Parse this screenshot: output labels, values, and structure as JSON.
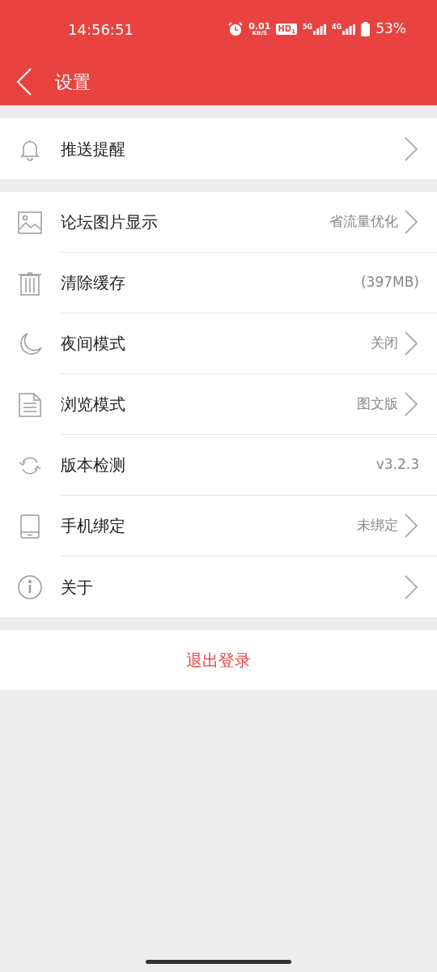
{
  "status_bar": {
    "time": "14:56:51",
    "net_speed": "0.01",
    "net_unit": "KB/S",
    "hd": "HD",
    "hd_index": "1",
    "sim1": "5G",
    "sim2": "4G",
    "battery": "53%"
  },
  "header": {
    "title": "设置"
  },
  "groups": [
    {
      "items": [
        {
          "kind": "bell",
          "label": "推送提醒",
          "chevron": true
        }
      ]
    },
    {
      "items": [
        {
          "kind": "image",
          "label": "论坛图片显示",
          "value": "省流量优化",
          "chevron": true
        },
        {
          "kind": "trash",
          "label": "清除缓存",
          "value": "(397MB)",
          "chevron": false
        },
        {
          "kind": "moon",
          "label": "夜间模式",
          "value": "关闭",
          "chevron": true
        },
        {
          "kind": "document",
          "label": "浏览模式",
          "value": "图文版",
          "chevron": true
        },
        {
          "kind": "refresh",
          "label": "版本检测",
          "value": "v3.2.3",
          "chevron": false
        },
        {
          "kind": "phone",
          "label": "手机绑定",
          "value": "未绑定",
          "chevron": true
        },
        {
          "kind": "info",
          "label": "关于",
          "chevron": true
        }
      ]
    }
  ],
  "logout": "退出登录"
}
